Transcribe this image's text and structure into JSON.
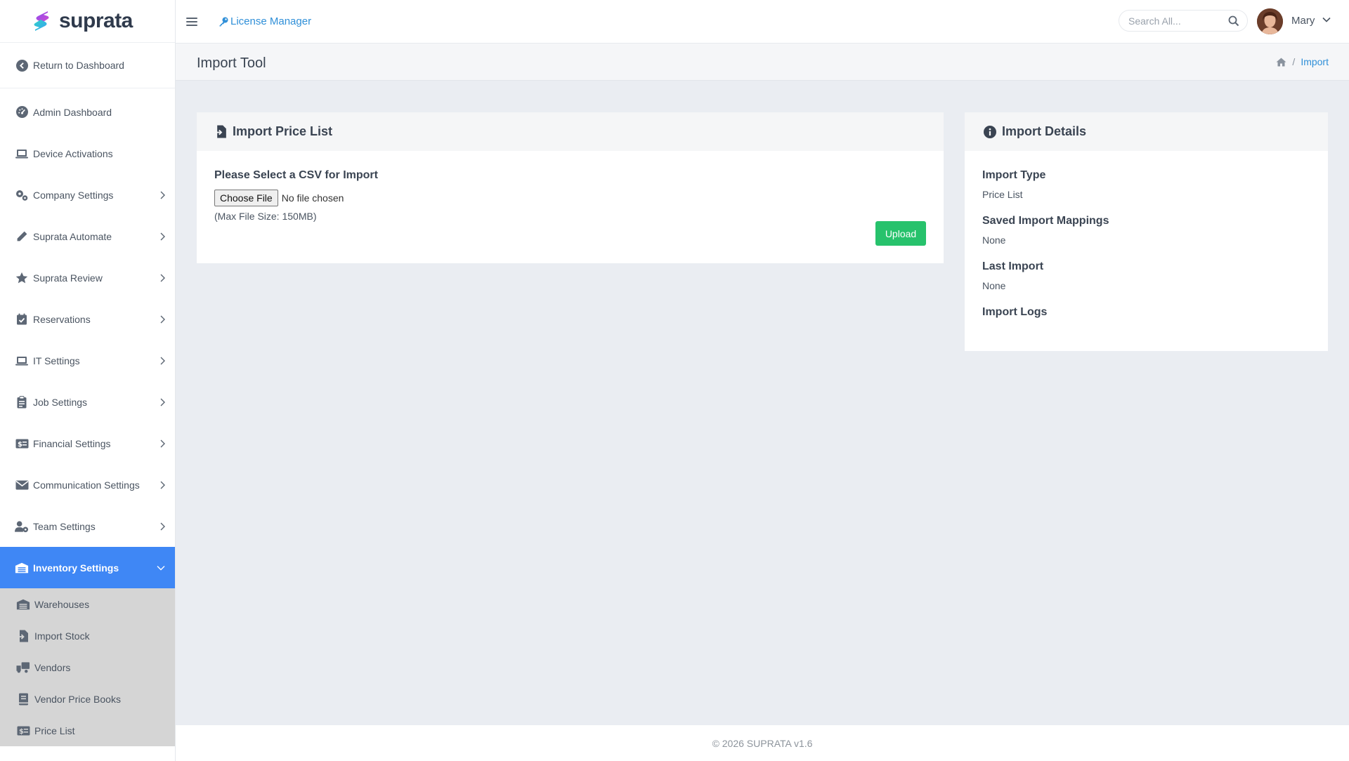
{
  "brand": {
    "name": "suprata"
  },
  "sidebar": {
    "return_label": "Return to Dashboard",
    "items": [
      {
        "label": "Admin Dashboard",
        "icon": "gauge-icon",
        "has_chevron": false
      },
      {
        "label": "Device Activations",
        "icon": "laptop-icon",
        "has_chevron": false
      },
      {
        "label": "Company Settings",
        "icon": "gears-icon",
        "has_chevron": true
      },
      {
        "label": "Suprata Automate",
        "icon": "pencil-icon",
        "has_chevron": true
      },
      {
        "label": "Suprata Review",
        "icon": "star-icon",
        "has_chevron": true
      },
      {
        "label": "Reservations",
        "icon": "calendar-check-icon",
        "has_chevron": true
      },
      {
        "label": "IT Settings",
        "icon": "laptop-icon",
        "has_chevron": true
      },
      {
        "label": "Job Settings",
        "icon": "clipboard-icon",
        "has_chevron": true
      },
      {
        "label": "Financial Settings",
        "icon": "money-check-icon",
        "has_chevron": true
      },
      {
        "label": "Communication Settings",
        "icon": "envelope-icon",
        "has_chevron": true
      },
      {
        "label": "Team Settings",
        "icon": "user-gear-icon",
        "has_chevron": true
      },
      {
        "label": "Inventory Settings",
        "icon": "warehouse-icon",
        "has_chevron": true,
        "active": true
      }
    ],
    "subitems": [
      {
        "label": "Warehouses",
        "icon": "warehouse-icon"
      },
      {
        "label": "Import Stock",
        "icon": "file-import-icon"
      },
      {
        "label": "Vendors",
        "icon": "truck-icon"
      },
      {
        "label": "Vendor Price Books",
        "icon": "book-icon"
      },
      {
        "label": "Price List",
        "icon": "money-check-icon"
      }
    ],
    "active_color": "#3f87f5"
  },
  "topbar": {
    "license_label": "License Manager",
    "search_placeholder": "Search All...",
    "user_name": "Mary"
  },
  "page": {
    "title": "Import Tool",
    "breadcrumb_current": "Import"
  },
  "import_card": {
    "title": "Import Price List",
    "prompt": "Please Select a CSV for Import",
    "file_button": "Choose File",
    "file_status": "No file chosen",
    "max_size": "(Max File Size: 150MB)",
    "upload_label": "Upload",
    "upload_color": "#27c26c"
  },
  "details_card": {
    "title": "Import Details",
    "import_type_label": "Import Type",
    "import_type_value": "Price List",
    "mappings_label": "Saved Import Mappings",
    "mappings_value": "None",
    "last_import_label": "Last Import",
    "last_import_value": "None",
    "logs_label": "Import Logs"
  },
  "footer": {
    "text": "© 2026 SUPRATA v1.6"
  }
}
